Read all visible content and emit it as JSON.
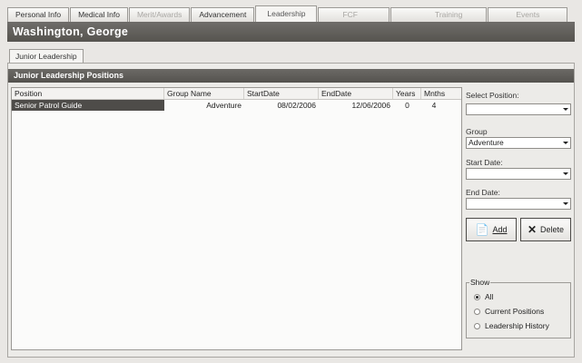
{
  "tabs": [
    {
      "label": "Personal Info",
      "state": "normal"
    },
    {
      "label": "Medical Info",
      "state": "normal"
    },
    {
      "label": "Merit/Awards",
      "state": "disabled"
    },
    {
      "label": "Advancement",
      "state": "normal"
    },
    {
      "label": "Leadership",
      "state": "active"
    },
    {
      "label": "FCF",
      "state": "disabled"
    },
    {
      "label": "Training",
      "state": "disabled"
    },
    {
      "label": "Events",
      "state": "disabled"
    }
  ],
  "header": {
    "name": "Washington, George"
  },
  "subtab": {
    "label": "Junior Leadership"
  },
  "section": {
    "title": "Junior Leadership Positions"
  },
  "list": {
    "columns": [
      "Position",
      "Group Name",
      "StartDate",
      "EndDate",
      "Years",
      "Mnths"
    ],
    "rows": [
      [
        "Senior Patrol Guide",
        "Adventure",
        "08/02/2006",
        "12/06/2006",
        "0",
        "4"
      ]
    ]
  },
  "form": {
    "select_position_label": "Select Position:",
    "select_position_value": "",
    "group_label": "Group",
    "group_value": "Adventure",
    "start_date_label": "Start Date:",
    "start_date_value": "",
    "end_date_label": "End Date:",
    "end_date_value": "",
    "add_label": "Add",
    "delete_label": "Delete"
  },
  "show": {
    "title": "Show",
    "options": [
      {
        "label": "All",
        "selected": true
      },
      {
        "label": "Current Positions",
        "selected": false
      },
      {
        "label": "Leadership History",
        "selected": false
      }
    ]
  },
  "icons": {
    "add": "add-document-icon",
    "delete": "delete-x-icon"
  },
  "colors": {
    "header_bg": "#5f5d59",
    "selected_row": "#4e4c49",
    "window_bg": "#e9e7e4"
  }
}
